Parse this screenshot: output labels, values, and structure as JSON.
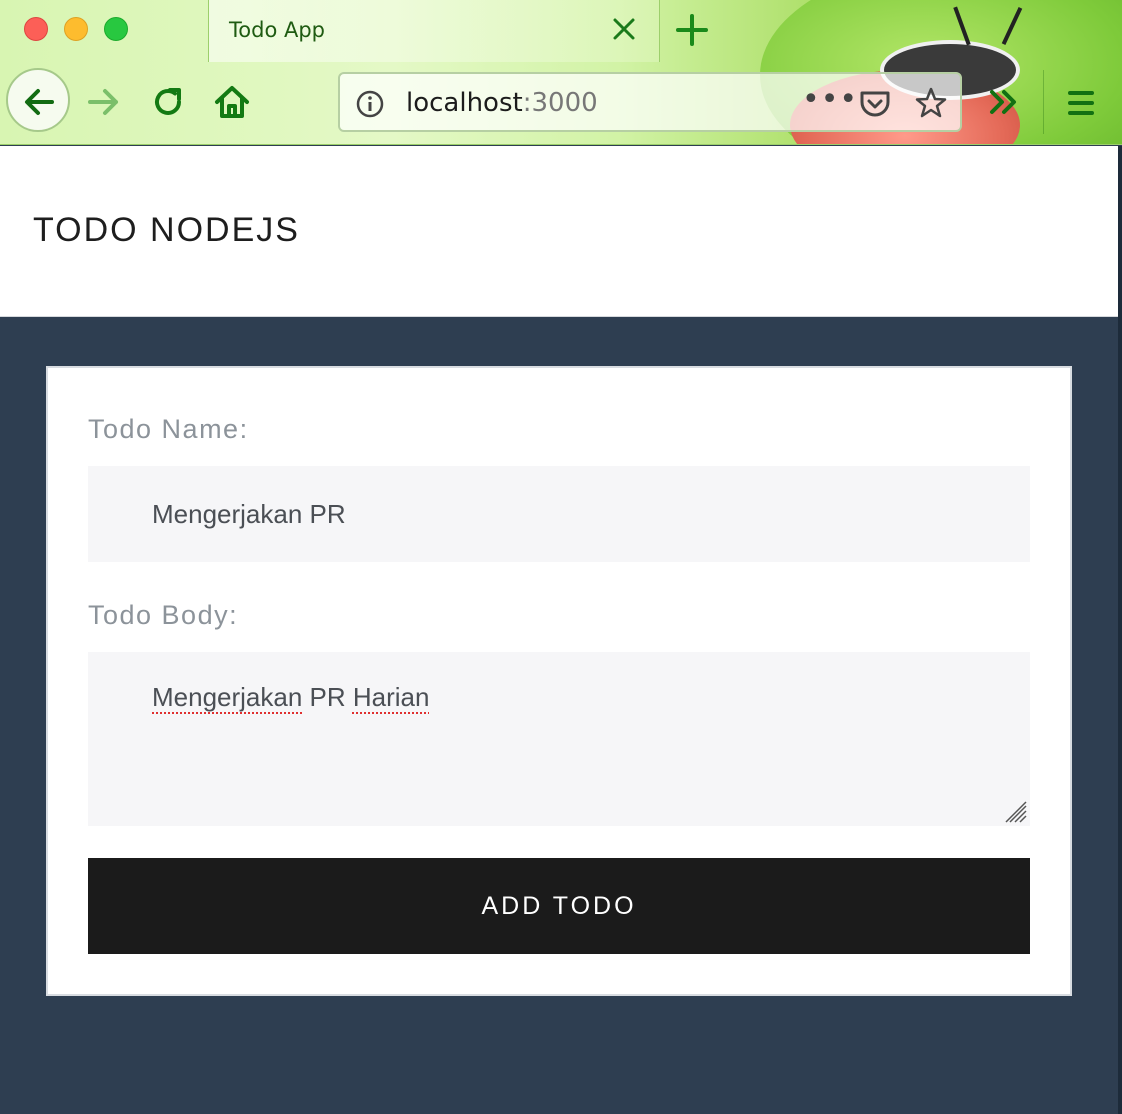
{
  "browser": {
    "tab_title": "Todo App",
    "url_host": "localhost",
    "url_port": ":3000",
    "more_label": "•••"
  },
  "page": {
    "title": "TODO NODEJS",
    "form": {
      "name_label": "Todo Name:",
      "name_value": "Mengerjakan PR",
      "body_label": "Todo Body:",
      "body_value": {
        "word1": "Mengerjakan",
        "word2": " PR ",
        "word3": "Harian"
      },
      "submit_label": "ADD TODO"
    }
  },
  "colors": {
    "page_background": "#2e3e51",
    "button_background": "#1b1b1b",
    "input_background": "#f6f6f8",
    "label_color": "#8c939a",
    "browser_accent": "#1a7a1a"
  },
  "icons": [
    "close-icon",
    "plus-icon",
    "back-arrow-icon",
    "forward-arrow-icon",
    "reload-icon",
    "home-icon",
    "info-icon",
    "pocket-icon",
    "star-icon",
    "double-chevron-icon",
    "hamburger-menu-icon",
    "resize-grip-icon"
  ]
}
